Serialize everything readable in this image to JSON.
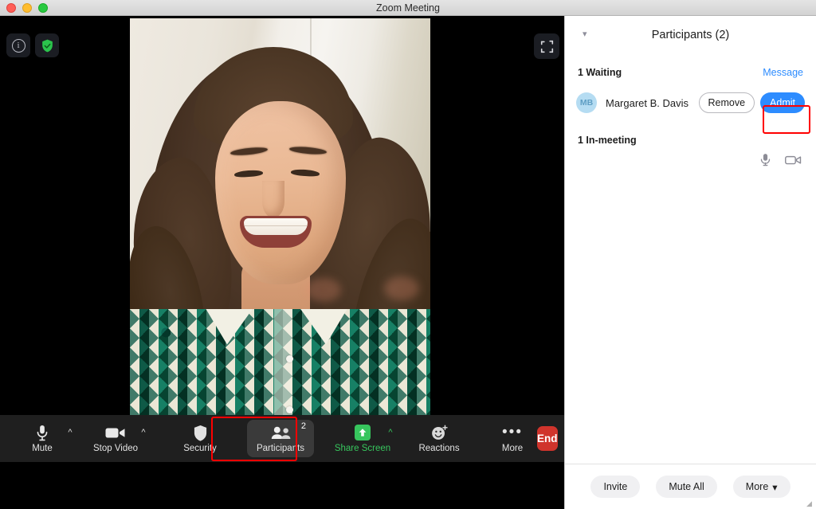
{
  "window": {
    "title": "Zoom Meeting",
    "traffic_lights": [
      "close",
      "minimize",
      "maximize"
    ]
  },
  "stage": {
    "info_icon": "info-icon",
    "encryption_icon": "green-shield-check-icon",
    "fullscreen_icon": "fullscreen-icon"
  },
  "toolbar": {
    "items": [
      {
        "label": "Mute",
        "icon": "microphone-icon",
        "caret": true,
        "caret_color": "#dcdcdc"
      },
      {
        "label": "Stop Video",
        "icon": "video-camera-icon",
        "caret": true,
        "caret_color": "#dcdcdc"
      },
      {
        "label": "Security",
        "icon": "shield-icon",
        "caret": false
      },
      {
        "label": "Participants",
        "icon": "people-icon",
        "caret": false,
        "badge": "2",
        "active": true
      },
      {
        "label": "Share Screen",
        "icon": "share-screen-icon",
        "caret": true,
        "caret_color": "#37c55d"
      },
      {
        "label": "Reactions",
        "icon": "reactions-icon",
        "caret": false
      },
      {
        "label": "More",
        "icon": "ellipsis-icon",
        "caret": false
      }
    ],
    "end_label": "End",
    "end_color": "#d0342c",
    "share_color": "#37c55d"
  },
  "panel": {
    "title": "Participants (2)",
    "collapse_icon": "chevron-down-icon",
    "waiting_label": "1 Waiting",
    "message_link": "Message",
    "waiting_participant": {
      "initials": "MB",
      "name": "Margaret B. Davis",
      "remove_label": "Remove",
      "admit_label": "Admit",
      "admit_color": "#2d8cff"
    },
    "inmeeting_label": "1 In-meeting",
    "self_icons": [
      "microphone-icon",
      "video-camera-icon"
    ],
    "footer": {
      "invite_label": "Invite",
      "mute_all_label": "Mute All",
      "more_label": "More",
      "more_caret": "⌄"
    }
  },
  "annotations": {
    "highlight_color": "#ff0000",
    "boxes": [
      "participants-toolbar-button",
      "admit-button"
    ]
  }
}
